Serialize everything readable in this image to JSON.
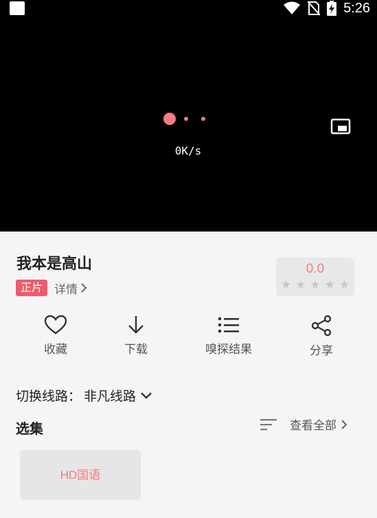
{
  "status_bar": {
    "time": "5:26",
    "icons": [
      "app-notification-icon",
      "wifi-icon",
      "no-sim-icon",
      "battery-charging-icon"
    ]
  },
  "player": {
    "speed": "0K/s",
    "loading_color": "#f47a85",
    "pip_icon": "picture-in-picture-icon"
  },
  "video": {
    "title": "我本是高山",
    "badge": "正片",
    "details_label": "详情",
    "rating": "0.0",
    "stars_filled": 0,
    "stars_total": 5
  },
  "actions": [
    {
      "label": "收藏",
      "icon": "heart-icon"
    },
    {
      "label": "下载",
      "icon": "download-arrow-icon"
    },
    {
      "label": "嗅探结果",
      "icon": "list-icon"
    },
    {
      "label": "分享",
      "icon": "share-icon"
    }
  ],
  "line_switch": {
    "label": "切换线路：",
    "value": "非凡线路"
  },
  "episodes": {
    "title": "选集",
    "view_all": "查看全部",
    "items": [
      "HD国语"
    ]
  },
  "colors": {
    "accent": "#f05b6c",
    "accent_light": "#f47a85",
    "player_bg": "#000000"
  }
}
